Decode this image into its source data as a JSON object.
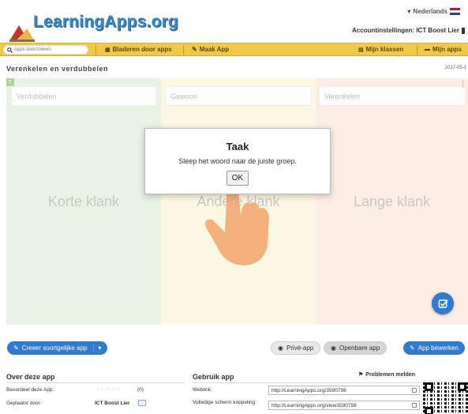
{
  "header": {
    "logo_text": "LearningApps.org",
    "language": "Nederlands",
    "account": "Accountinstellingen: ICT Boost Lier"
  },
  "nav": {
    "search_placeholder": "Apps doorzoeken",
    "browse": "Bladeren door apps",
    "create": "Maak App",
    "classes": "Mijn klassen",
    "my_apps": "Mijn apps"
  },
  "app": {
    "title": "Verenkelen en verdubbelen",
    "date": "2017-05-1",
    "columns": [
      {
        "header": "Verdubbelen",
        "label": "Korte klank"
      },
      {
        "header": "Gewoon",
        "label": "Andere klank"
      },
      {
        "header": "Verenkelen",
        "label": "Lange klank"
      }
    ]
  },
  "modal": {
    "title": "Taak",
    "message": "Sleep het woord naar de juiste groep.",
    "ok": "OK"
  },
  "actions": {
    "create_similar": "Creeer soortgelijke app",
    "private": "Privé-app",
    "public": "Openbare app",
    "edit": "App bewerken"
  },
  "about": {
    "title": "Over deze app",
    "rated_label": "Beoordeel deze App:",
    "rating_count": "(0)",
    "rating": 0,
    "posted_label": "Geplaatst door:",
    "posted_by": "ICT Boost Lier"
  },
  "use": {
    "title": "Gebruik app",
    "report": "Problemen melden",
    "weblink_label": "Weblink:",
    "weblink": "http://LearningApps.org/3590798",
    "fullscreen_label": "Volledige scherm koppeling:",
    "fullscreen": "http://LearningApps.org/view3590798"
  },
  "colors": {
    "nav": "#f2c84b",
    "accent": "#2f7bd1",
    "green": "#d6ead0",
    "yellow": "#fbf2cc",
    "orange": "#fbe0cf"
  }
}
